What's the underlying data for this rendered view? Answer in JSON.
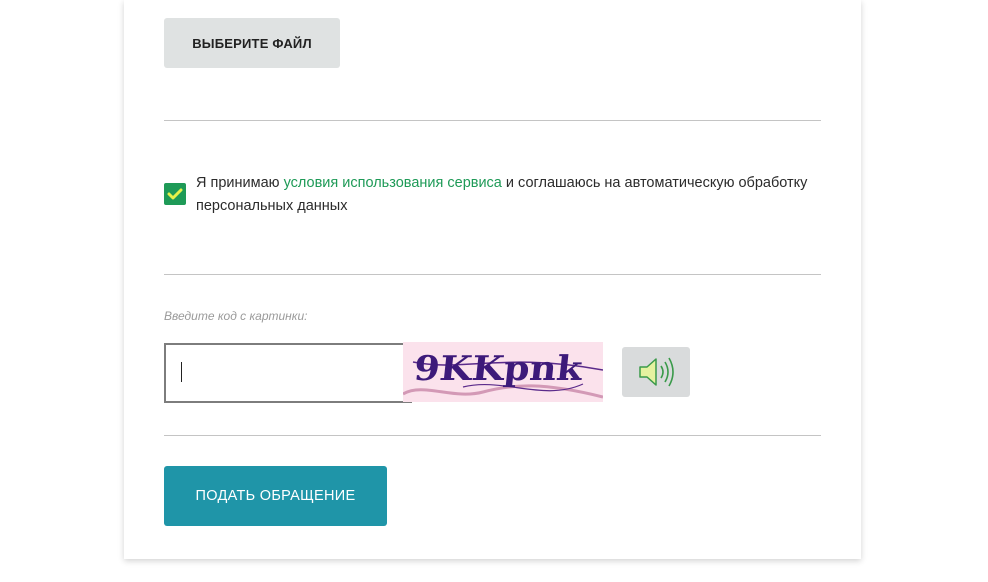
{
  "file_upload": {
    "button_label": "ВЫБЕРИТЕ ФАЙЛ"
  },
  "agreement": {
    "checked": true,
    "text_before": "Я принимаю ",
    "link_text": "условия использования сервиса",
    "text_after": " и соглашаюсь на автоматическую обработку персональных данных"
  },
  "captcha": {
    "label": "Введите код с картинки:",
    "input_value": "",
    "image_text": "9KKpnk",
    "audio_icon": "speaker-icon"
  },
  "submit": {
    "label": "ПОДАТЬ ОБРАЩЕНИЕ"
  },
  "colors": {
    "accent_green": "#1e9a57",
    "submit_teal": "#1f95a8",
    "captcha_text": "#3d1a7a"
  }
}
